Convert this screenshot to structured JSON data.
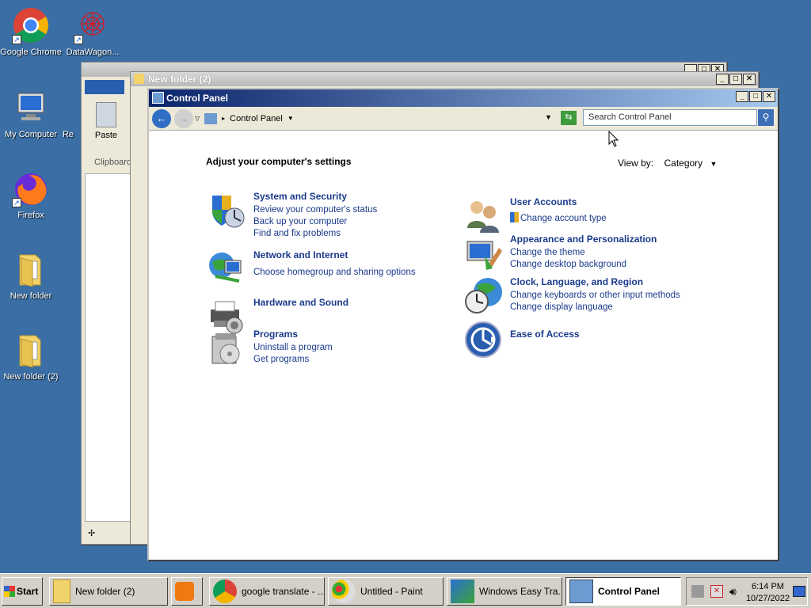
{
  "desktop": {
    "icons": [
      {
        "label": "Google Chrome"
      },
      {
        "label": "DataWagon..."
      },
      {
        "label": "My Computer"
      },
      {
        "label": "Re"
      },
      {
        "label": "Firefox"
      },
      {
        "label": "New folder"
      },
      {
        "label": "New folder (2)"
      }
    ]
  },
  "paint_window": {
    "paste_label": "Paste",
    "clipboard_label": "Clipboard"
  },
  "folder_window": {
    "title": "New folder (2)"
  },
  "control_panel": {
    "title": "Control Panel",
    "address": "Control Panel",
    "search_placeholder": "Search Control Panel",
    "heading": "Adjust your computer's settings",
    "view_by_label": "View by:",
    "view_by_value": "Category",
    "categories": [
      {
        "title": "System and Security",
        "links": [
          "Review your computer's status",
          "Back up your computer",
          "Find and fix problems"
        ],
        "icon": "shield-icon"
      },
      {
        "title": "Network and Internet",
        "links": [
          "Choose homegroup and sharing options"
        ],
        "icon": "network-icon"
      },
      {
        "title": "Hardware and Sound",
        "links": [],
        "icon": "printer-icon"
      },
      {
        "title": "Programs",
        "links": [
          "Uninstall a program",
          "Get programs"
        ],
        "icon": "programs-icon"
      },
      {
        "title": "User Accounts",
        "links": [
          "Change account type"
        ],
        "icon": "users-icon"
      },
      {
        "title": "Appearance and Personalization",
        "links": [
          "Change the theme",
          "Change desktop background"
        ],
        "icon": "monitor-icon"
      },
      {
        "title": "Clock, Language, and Region",
        "links": [
          "Change keyboards or other input methods",
          "Change display language"
        ],
        "icon": "clock-globe-icon"
      },
      {
        "title": "Ease of Access",
        "links": [],
        "icon": "ease-of-access-icon"
      }
    ]
  },
  "taskbar": {
    "start": "Start",
    "tasks": [
      {
        "label": "New folder (2)"
      },
      {
        "label": ""
      },
      {
        "label": "google translate - ..."
      },
      {
        "label": "Untitled - Paint"
      },
      {
        "label": "Windows Easy Tra..."
      },
      {
        "label": "Control Panel"
      }
    ],
    "time": "6:14 PM",
    "date": "10/27/2022"
  }
}
